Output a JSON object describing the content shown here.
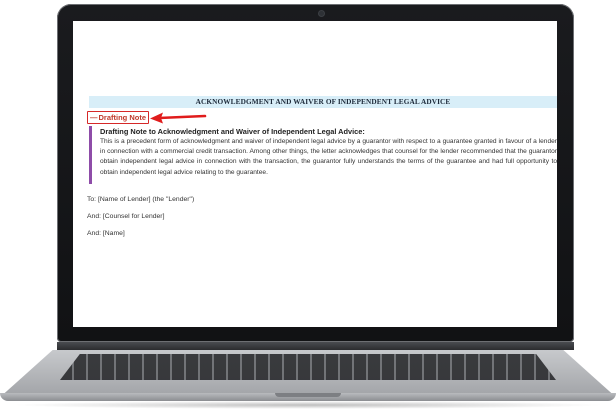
{
  "document": {
    "title": "ACKNOWLEDGMENT AND WAIVER OF INDEPENDENT LEGAL ADVICE",
    "drafting_toggle": {
      "symbol": "—",
      "label": "Drafting Note"
    },
    "drafting_note": {
      "heading": "Drafting Note to Acknowledgment and Waiver of Independent Legal Advice:",
      "body": "This is a precedent form of acknowledgment and waiver of independent legal advice by a guarantor with respect to a guarantee granted in favour of a lender in connection with a commercial credit transaction. Among other things, the letter acknowledges that counsel for the lender recommended that the guarantor obtain independent legal advice in connection with the transaction, the guarantor fully understands the terms of the guarantee and had full opportunity to obtain independent legal advice relating to the guarantee."
    },
    "addresses": [
      "To: [Name of Lender] (the \"Lender\")",
      "And: [Counsel for Lender]",
      "And: [Name]"
    ]
  },
  "colors": {
    "title_bar_bg": "#d8eef8",
    "toggle_red": "#d62828",
    "note_accent": "#8e4ca8"
  },
  "icons": {
    "toggle": "minus-icon",
    "pointer": "red-arrow-icon"
  }
}
